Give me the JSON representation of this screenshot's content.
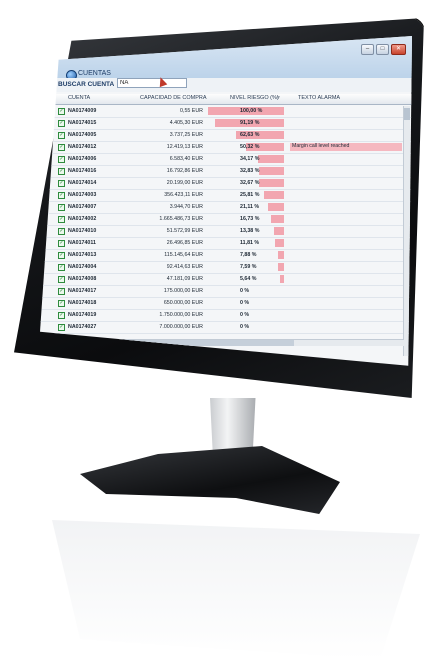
{
  "window": {
    "title": "CUENTAS"
  },
  "search": {
    "label": "BUSCAR CUENTA",
    "value": "NA"
  },
  "grid": {
    "headers": {
      "account": "CUENTA",
      "capacity": "CAPACIDAD DE COMPRA",
      "risk": "NIVEL RIESGO (%)",
      "alarm": "TEXTO ALARMA"
    },
    "rows": [
      {
        "account": "NA0174009",
        "capacity": "0,55  EUR",
        "risk": "100,00 %",
        "risk_value": 100.0,
        "alarm": ""
      },
      {
        "account": "NA0174015",
        "capacity": "4.405,30  EUR",
        "risk": "91,19 %",
        "risk_value": 91.19,
        "alarm": ""
      },
      {
        "account": "NA0174005",
        "capacity": "3.737,25  EUR",
        "risk": "62,63 %",
        "risk_value": 62.63,
        "alarm": ""
      },
      {
        "account": "NA0174012",
        "capacity": "12.419,13  EUR",
        "risk": "50,32 %",
        "risk_value": 50.32,
        "alarm": "Margin call level reached"
      },
      {
        "account": "NA0174006",
        "capacity": "6.583,40  EUR",
        "risk": "34,17 %",
        "risk_value": 34.17,
        "alarm": ""
      },
      {
        "account": "NA0174016",
        "capacity": "16.792,86  EUR",
        "risk": "32,83 %",
        "risk_value": 32.83,
        "alarm": ""
      },
      {
        "account": "NA0174014",
        "capacity": "20.199,00  EUR",
        "risk": "32,67 %",
        "risk_value": 32.67,
        "alarm": ""
      },
      {
        "account": "NA0174003",
        "capacity": "356.423,11  EUR",
        "risk": "25,81 %",
        "risk_value": 25.81,
        "alarm": ""
      },
      {
        "account": "NA0174007",
        "capacity": "3.944,70  EUR",
        "risk": "21,11 %",
        "risk_value": 21.11,
        "alarm": ""
      },
      {
        "account": "NA0174002",
        "capacity": "1.665.486,73  EUR",
        "risk": "16,73 %",
        "risk_value": 16.73,
        "alarm": ""
      },
      {
        "account": "NA0174010",
        "capacity": "51.572,99  EUR",
        "risk": "13,38 %",
        "risk_value": 13.38,
        "alarm": ""
      },
      {
        "account": "NA0174011",
        "capacity": "26.496,85  EUR",
        "risk": "11,81 %",
        "risk_value": 11.81,
        "alarm": ""
      },
      {
        "account": "NA0174013",
        "capacity": "115.145,64  EUR",
        "risk": "7,88 %",
        "risk_value": 7.88,
        "alarm": ""
      },
      {
        "account": "NA0174004",
        "capacity": "92.414,63  EUR",
        "risk": "7,59 %",
        "risk_value": 7.59,
        "alarm": ""
      },
      {
        "account": "NA0174008",
        "capacity": "47.181,09  EUR",
        "risk": "5,64 %",
        "risk_value": 5.64,
        "alarm": ""
      },
      {
        "account": "NA0174017",
        "capacity": "175.000,00  EUR",
        "risk": "0 %",
        "risk_value": 0,
        "alarm": ""
      },
      {
        "account": "NA0174018",
        "capacity": "650.000,00  EUR",
        "risk": "0 %",
        "risk_value": 0,
        "alarm": ""
      },
      {
        "account": "NA0174019",
        "capacity": "1.750.000,00  EUR",
        "risk": "0 %",
        "risk_value": 0,
        "alarm": ""
      },
      {
        "account": "NA0174027",
        "capacity": "7.000.000,00  EUR",
        "risk": "0 %",
        "risk_value": 0,
        "alarm": ""
      }
    ]
  },
  "icons": {
    "app": "cuentas-app-icon",
    "minimize": "minimize-icon",
    "maximize": "maximize-icon",
    "close": "close-icon",
    "checkbox": "checkbox-checked-icon",
    "filter": "filter-icon"
  },
  "colors": {
    "risk_bar": "#f2a6b0",
    "alarm_highlight": "#f5b8c0",
    "checkbox": "#2e8b3d",
    "titlebar": "#bcd3ea"
  }
}
